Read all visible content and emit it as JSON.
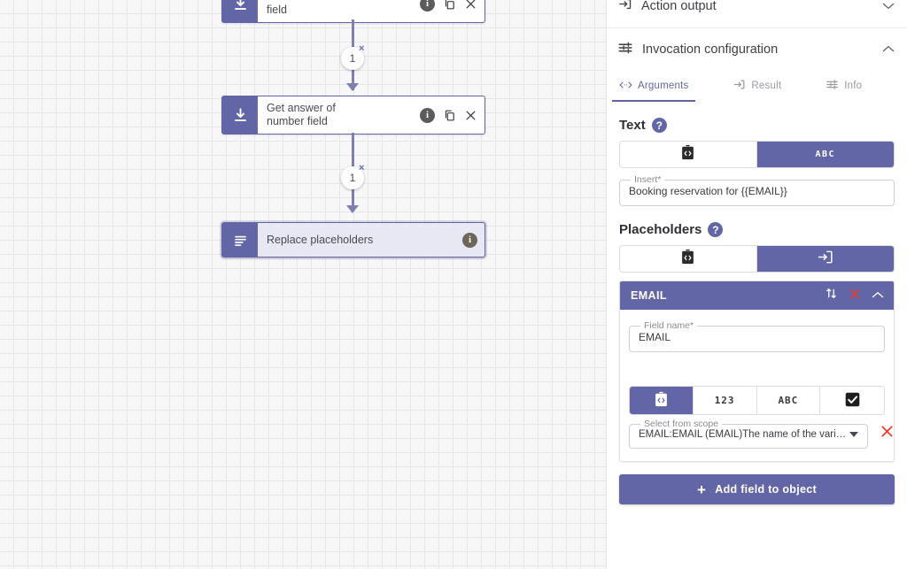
{
  "canvas": {
    "nodes": [
      {
        "id": "date",
        "title": "Get answer of date\nfield",
        "icon": "download-icon",
        "selected": false,
        "actions": [
          "info-icon",
          "copy-icon",
          "close-icon"
        ]
      },
      {
        "id": "number",
        "title": "Get answer of\nnumber field",
        "icon": "download-icon",
        "selected": false,
        "actions": [
          "info-icon",
          "copy-icon",
          "close-icon"
        ]
      },
      {
        "id": "replace",
        "title": "Replace placeholders",
        "icon": "list-icon",
        "selected": true,
        "actions": [
          "info-icon"
        ]
      }
    ],
    "edges": [
      {
        "label": "1",
        "remove_label": "×"
      },
      {
        "label": "1",
        "remove_label": "×"
      }
    ]
  },
  "panel": {
    "sections": [
      {
        "id": "action-output",
        "title": "Action output",
        "icon": "output-icon",
        "expanded": false,
        "chevron": "∨"
      },
      {
        "id": "invocation-configuration",
        "title": "Invocation configuration",
        "icon": "sliders-icon",
        "expanded": true,
        "chevron": "∧"
      }
    ],
    "tabs": [
      {
        "id": "arguments",
        "label": "Arguments",
        "icon": "code-icon",
        "active": true
      },
      {
        "id": "result",
        "label": "Result",
        "icon": "output-icon",
        "active": false
      },
      {
        "id": "info",
        "label": "Info",
        "icon": "sliders-icon",
        "active": false
      }
    ],
    "text_section": {
      "title": "Text",
      "help": "?",
      "toggle": [
        {
          "id": "code",
          "icon": "clipboard-code-icon",
          "active": false
        },
        {
          "id": "string",
          "icon": "abc-icon",
          "label": "ABC",
          "active": true
        }
      ],
      "input": {
        "legend": "Insert*",
        "value": "Booking reservation for {{EMAIL}}"
      }
    },
    "placeholders_section": {
      "title": "Placeholders",
      "help": "?",
      "toggle": [
        {
          "id": "code",
          "icon": "clipboard-code-icon",
          "active": false
        },
        {
          "id": "object",
          "icon": "input-box-icon",
          "active": true
        }
      ],
      "card": {
        "header": {
          "title": "EMAIL",
          "sort_icon": "sort-icon",
          "delete_icon": "delete-x-icon",
          "collapse_icon": "chevron-up-icon",
          "collapse_glyph": "∧"
        },
        "field_name": {
          "legend": "Field name*",
          "value": "EMAIL"
        },
        "type_toggle": [
          {
            "id": "code",
            "icon": "clipboard-code-icon",
            "active": true
          },
          {
            "id": "number",
            "label": "123",
            "active": false
          },
          {
            "id": "string",
            "label": "ABC",
            "active": false
          },
          {
            "id": "boolean",
            "icon": "checkbox-icon",
            "active": false
          }
        ],
        "scope": {
          "legend": "Select from scope",
          "value": "EMAIL:EMAIL (EMAIL)The name of the vari…",
          "clear_icon": "clear-x-icon",
          "search_icon": "search-icon"
        }
      }
    },
    "add_field_button": {
      "label": "Add field to object",
      "plus": "+"
    }
  },
  "colors": {
    "accent": "#6366a6",
    "accent_soft": "#e8e7f4",
    "edge": "#7f7fb0",
    "danger": "#ea3323",
    "canvas_bg": "#f7f7f8",
    "grid_line": "#e6e6e8"
  }
}
